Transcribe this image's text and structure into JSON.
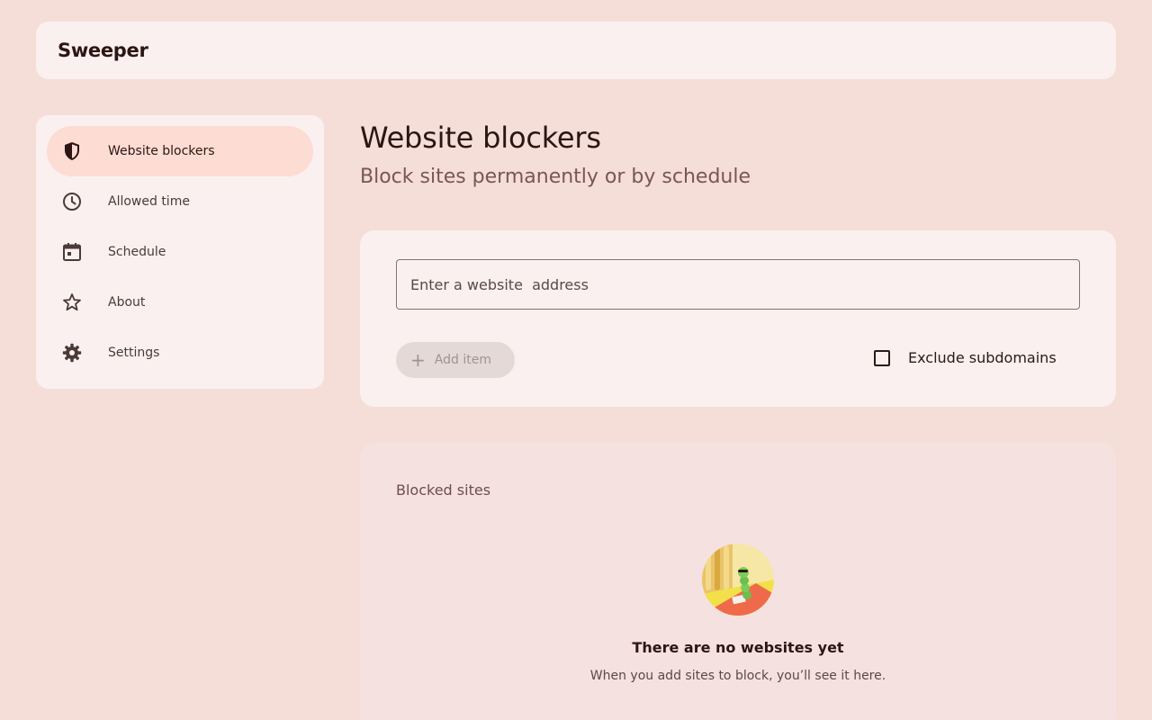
{
  "app": {
    "title": "Sweeper"
  },
  "sidebar": {
    "items": [
      {
        "label": "Website blockers",
        "icon": "shield-icon",
        "active": true
      },
      {
        "label": "Allowed time",
        "icon": "clock-icon",
        "active": false
      },
      {
        "label": "Schedule",
        "icon": "calendar-icon",
        "active": false
      },
      {
        "label": "About",
        "icon": "star-icon",
        "active": false
      },
      {
        "label": "Settings",
        "icon": "gear-icon",
        "active": false
      }
    ]
  },
  "page": {
    "title": "Website blockers",
    "subtitle": "Block sites permanently or by schedule"
  },
  "add_form": {
    "input_placeholder": "Enter a website  address",
    "input_value": "",
    "add_button_label": "Add item",
    "add_button_enabled": false,
    "exclude_subdomains_label": "Exclude subdomains",
    "exclude_subdomains_checked": false
  },
  "blocked_sites": {
    "title": "Blocked sites",
    "items": [],
    "empty_title": "There are no websites yet",
    "empty_description": "When you add sites to block, you’ll see it here."
  },
  "colors": {
    "background": "#f5ded8",
    "surface": "#faf0ef",
    "active_nav": "#fddcd3",
    "list_surface": "#f4e1e0",
    "text_primary": "#2b1613",
    "text_secondary": "#7a5751"
  }
}
